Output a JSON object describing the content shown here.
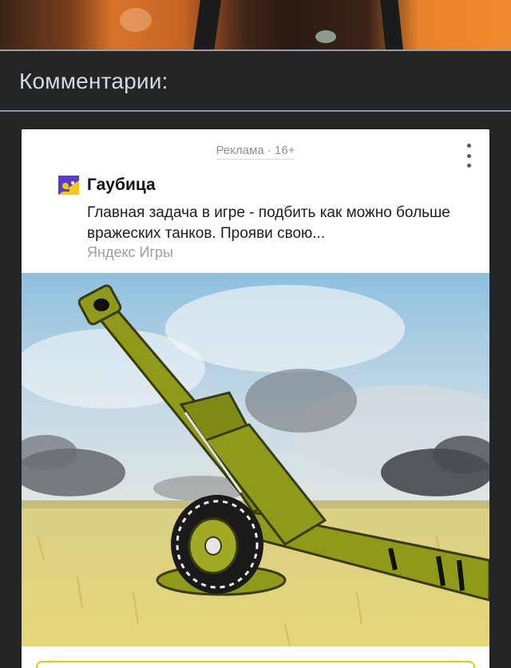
{
  "comments": {
    "title": "Комментарии:"
  },
  "ad": {
    "label": "Реклама · 16+",
    "title": "Гаубица",
    "description": "Главная задача в игре - подбить как можно больше вражеских танков. Прояви свою...",
    "source": "Яндекс Игры",
    "image_icon": "howitzer-artillery-illustration",
    "menu_icon": "more-vertical-icon",
    "accent": "#f2c300"
  }
}
